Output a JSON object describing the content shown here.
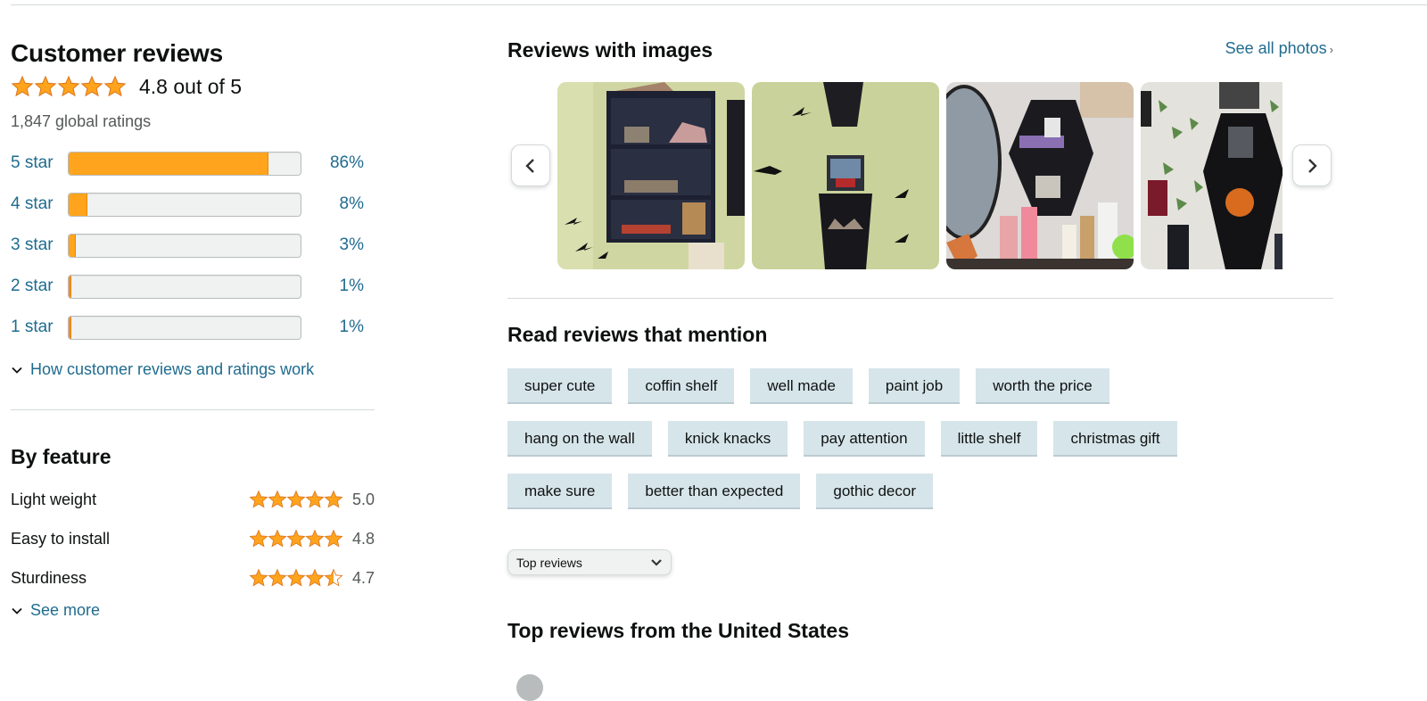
{
  "customer_reviews": {
    "title": "Customer reviews",
    "overall_rating": 4.8,
    "overall_text": "4.8 out of 5",
    "global_ratings": "1,847 global ratings",
    "histogram": [
      {
        "label": "5 star",
        "percent": 86,
        "percent_text": "86%"
      },
      {
        "label": "4 star",
        "percent": 8,
        "percent_text": "8%"
      },
      {
        "label": "3 star",
        "percent": 3,
        "percent_text": "3%"
      },
      {
        "label": "2 star",
        "percent": 1,
        "percent_text": "1%"
      },
      {
        "label": "1 star",
        "percent": 1,
        "percent_text": "1%"
      }
    ],
    "how_it_works_link": "How customer reviews and ratings work"
  },
  "by_feature": {
    "title": "By feature",
    "features": [
      {
        "name": "Light weight",
        "rating": 5.0,
        "rating_text": "5.0"
      },
      {
        "name": "Easy to install",
        "rating": 4.8,
        "rating_text": "4.8"
      },
      {
        "name": "Sturdiness",
        "rating": 4.7,
        "rating_text": "4.7"
      }
    ],
    "see_more_link": "See more"
  },
  "reviews_with_images": {
    "title": "Reviews with images",
    "see_all_link": "See all photos",
    "see_all_icon": "chevron-right-icon",
    "prev_icon": "chevron-left-icon",
    "next_icon": "chevron-right-icon",
    "images": [
      {
        "description": "black wall shelf on green wall with bat decals"
      },
      {
        "description": "coffin shelf on green wall with bat decals"
      },
      {
        "description": "coffin shelf on vanity with cosmetics"
      },
      {
        "description": "coffin shelf with pumpkin among ivy"
      }
    ]
  },
  "mentions": {
    "title": "Read reviews that mention",
    "chips": [
      "super cute",
      "coffin shelf",
      "well made",
      "paint job",
      "worth the price",
      "hang on the wall",
      "knick knacks",
      "pay attention",
      "little shelf",
      "christmas gift",
      "make sure",
      "better than expected",
      "gothic decor"
    ]
  },
  "sort": {
    "selected": "Top reviews",
    "icon": "chevron-down-icon"
  },
  "top_reviews": {
    "title": "Top reviews from the United States"
  },
  "colors": {
    "star": "#ffa41c",
    "link": "#1f6b8f",
    "chip_bg": "#d6e5ea"
  }
}
